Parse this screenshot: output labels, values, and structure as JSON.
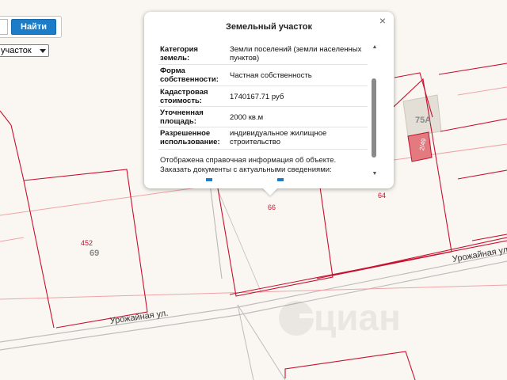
{
  "search": {
    "button_label": "Найти",
    "input_value": ""
  },
  "layer_select": {
    "selected": "участок"
  },
  "popup": {
    "title": "Земельный участок",
    "close_symbol": "×",
    "rows": [
      {
        "label": "Категория земель:",
        "value": "Земли поселений (земли населенных пунктов)"
      },
      {
        "label": "Форма собственности:",
        "value": "Частная собственность"
      },
      {
        "label": "Кадастровая стоимость:",
        "value": "1740167.71 руб"
      },
      {
        "label": "Уточненная площадь:",
        "value": "2000 кв.м"
      },
      {
        "label": "Разрешенное использование:",
        "value": "индивидуальное жилищное строительство"
      }
    ],
    "note": "Отображена справочная информация об объекте. Заказать документы с актуальными сведениями:",
    "scroll_up": "▲",
    "scroll_down": "▼"
  },
  "map": {
    "parcel_labels": [
      {
        "text": "452"
      },
      {
        "text": "66"
      },
      {
        "text": "64"
      },
      {
        "text": "2/49"
      }
    ],
    "block_labels": [
      {
        "text": "69"
      },
      {
        "text": "75A"
      }
    ],
    "street_labels": [
      {
        "text": "Урожайная ул."
      },
      {
        "text": "Урожайная ул."
      }
    ],
    "watermark": "циан",
    "colors": {
      "parcel_border": "#c8102e",
      "street": "#bdbdbd",
      "background": "#faf7f2",
      "accent": "#1d7cc8"
    }
  }
}
